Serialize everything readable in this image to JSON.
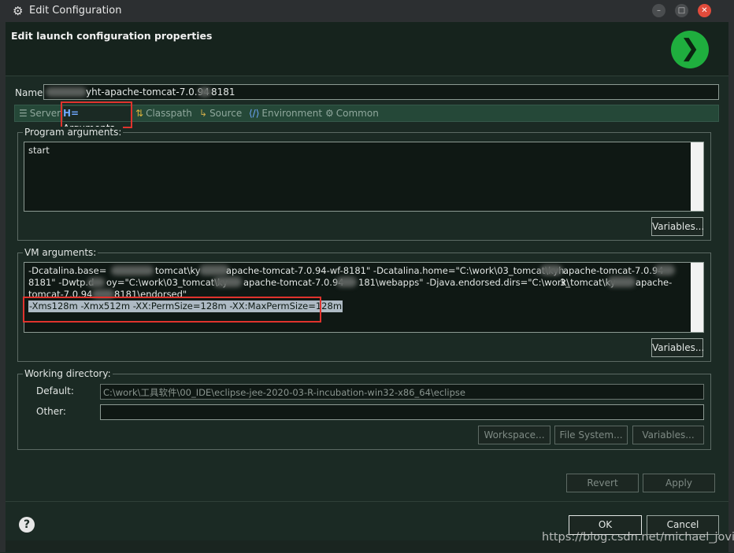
{
  "window": {
    "title": "Edit Configuration",
    "header_title": "Edit launch configuration properties"
  },
  "name_field": {
    "label": "Name:",
    "value": "yht-apache-tomcat-7.0.94",
    "value_suffix": "8181"
  },
  "tabs": [
    {
      "label": "Server",
      "icon": "server-icon"
    },
    {
      "label": "Arguments",
      "icon": "arguments-icon"
    },
    {
      "label": "Classpath",
      "icon": "classpath-icon"
    },
    {
      "label": "Source",
      "icon": "source-icon"
    },
    {
      "label": "Environment",
      "icon": "environment-icon"
    },
    {
      "label": "Common",
      "icon": "common-icon"
    }
  ],
  "program_arguments": {
    "title": "Program arguments:",
    "value": "start",
    "variables_button": "Variables..."
  },
  "vm_arguments": {
    "title": "VM arguments:",
    "line1a": "-Dcatalina.base=",
    "line1b": "tomcat\\ky",
    "line1c": "apache-tomcat-7.0.94-wf-8181\" -Dcatalina.home=\"C:\\work\\03_tomcat\\kyh",
    "line1d": "apache-tomcat-7.0.94",
    "line2a": "8181\" -Dwtp.d",
    "line2b": "oy=\"C:\\work\\03_tomcat\\ky",
    "line2c": "apache-tomcat-7.0.94",
    "line2d": "181\\webapps\" -Djava.endorsed.dirs=\"C:\\work\\",
    "line2e": "3_tomcat\\ky",
    "line2f": "apache-",
    "line3a": "tomcat-7.0.94",
    "line3b": "8181\\endorsed\"",
    "highlighted": "-Xms128m -Xmx512m -XX:PermSize=128m -XX:MaxPermSize=128m",
    "variables_button": "Variables..."
  },
  "working_directory": {
    "title": "Working directory:",
    "default_label": "Default:",
    "default_value": "C:\\work\\工具软件\\00_IDE\\eclipse-jee-2020-03-R-incubation-win32-x86_64\\eclipse",
    "other_label": "Other:",
    "other_value": "",
    "workspace_button": "Workspace...",
    "filesystem_button": "File System...",
    "variables_button": "Variables..."
  },
  "actions": {
    "revert": "Revert",
    "apply": "Apply",
    "ok": "OK",
    "cancel": "Cancel"
  },
  "watermark": "https://blog.csdn.net/michael_jovi",
  "colors": {
    "highlight_box": "#e0332d",
    "run_icon": "#1fae3e",
    "close_button": "#e24b3b"
  }
}
